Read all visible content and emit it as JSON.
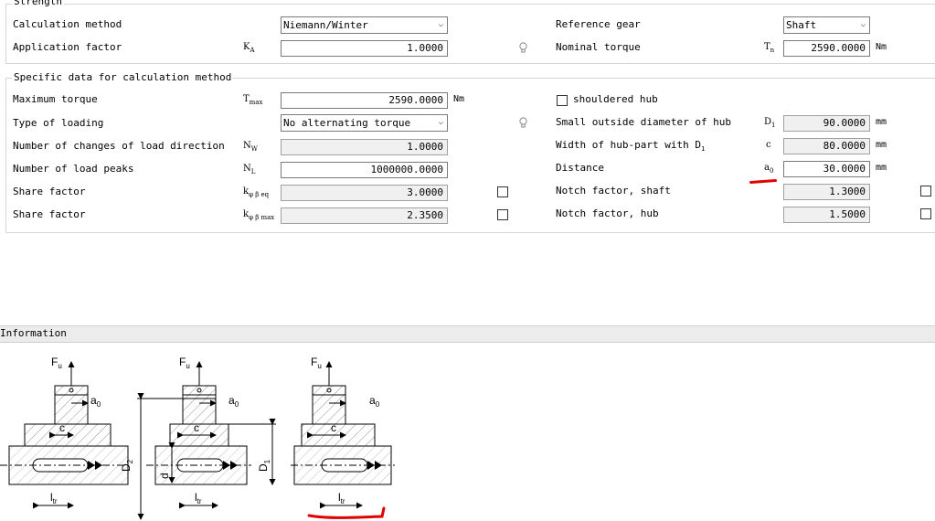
{
  "strength": {
    "legend": "Strength",
    "calc_method_label": "Calculation method",
    "calc_method_value": "Niemann/Winter",
    "app_factor_label": "Application factor",
    "app_factor_sym": "K",
    "app_factor_sub": "A",
    "app_factor_value": "1.0000",
    "ref_gear_label": "Reference gear",
    "ref_gear_value": "Shaft",
    "nominal_torque_label": "Nominal torque",
    "nominal_torque_sym": "T",
    "nominal_torque_sub": "n",
    "nominal_torque_value": "2590.0000",
    "nominal_torque_unit": "Nm"
  },
  "specific": {
    "legend": "Specific data for calculation method",
    "max_torque_label": "Maximum torque",
    "max_torque_sym": "T",
    "max_torque_sub": "max",
    "max_torque_value": "2590.0000",
    "max_torque_unit": "Nm",
    "loading_label": "Type of loading",
    "loading_value": "No alternating torque",
    "changes_label": "Number of changes of load direction",
    "changes_sym": "N",
    "changes_sub": "W",
    "changes_value": "1.0000",
    "peaks_label": "Number of load peaks",
    "peaks_sym": "N",
    "peaks_sub": "L",
    "peaks_value": "1000000.0000",
    "share1_label": "Share factor",
    "share1_sym": "k",
    "share1_sub": "φ β eq",
    "share1_value": "3.0000",
    "share2_label": "Share factor",
    "share2_sym": "k",
    "share2_sub": "φ β max",
    "share2_value": "2.3500",
    "shouldered_hub_label": "shouldered hub",
    "small_diam_label": "Small outside diameter of hub",
    "small_diam_sym": "D",
    "small_diam_sub": "1",
    "small_diam_value": "90.0000",
    "small_diam_unit": "mm",
    "width_label": "Width of hub-part with D",
    "width_label_sub": "1",
    "width_sym": "c",
    "width_value": "80.0000",
    "width_unit": "mm",
    "distance_label": "Distance",
    "distance_sym": "a",
    "distance_sub": "0",
    "distance_value": "30.0000",
    "distance_unit": "mm",
    "notch_shaft_label": "Notch factor, shaft",
    "notch_shaft_value": "1.3000",
    "notch_hub_label": "Notch factor, hub",
    "notch_hub_value": "1.5000"
  },
  "information": {
    "title": "Information",
    "labels": {
      "fu": "F",
      "fu_sub": "u",
      "a0": "a",
      "a0_sub": "0",
      "c": "c",
      "ltr": "l",
      "ltr_sub": "tr",
      "d1": "D",
      "d1_sub": "1",
      "d2": "D",
      "d2_sub": "2",
      "d": "d"
    }
  },
  "colors": {
    "annotation": "#e00000",
    "readonly_bg": "#f0f0f0",
    "info_bar": "#ececec"
  }
}
